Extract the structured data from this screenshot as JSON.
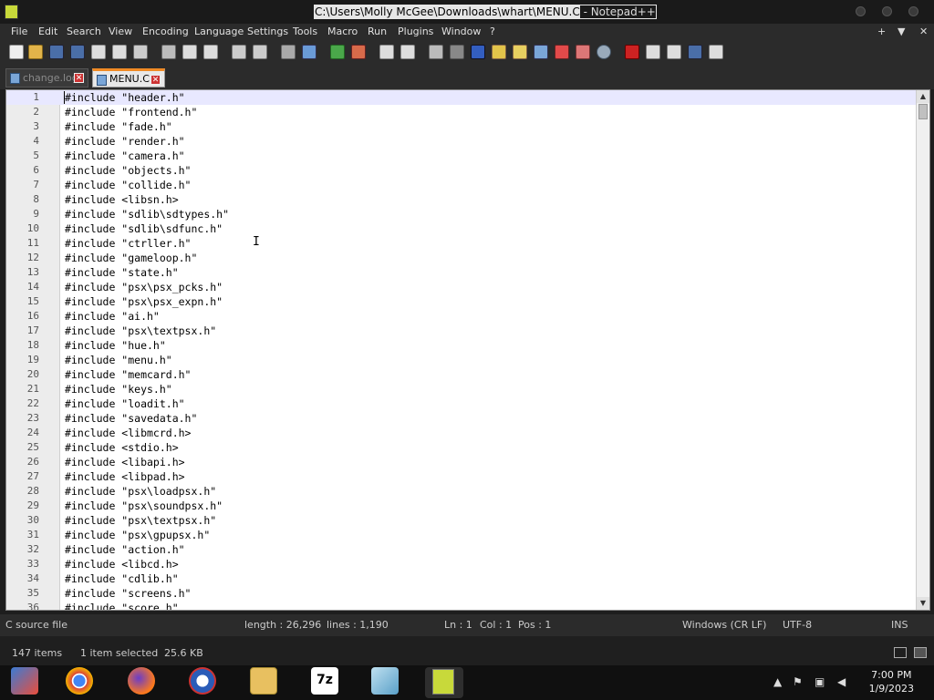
{
  "window": {
    "title_selected": "C:\\Users\\Molly McGee\\Downloads\\whart\\MENU.C",
    "title_rest": " - Notepad++"
  },
  "menu": [
    "File",
    "Edit",
    "Search",
    "View",
    "Encoding",
    "Language",
    "Settings",
    "Tools",
    "Macro",
    "Run",
    "Plugins",
    "Window",
    "?"
  ],
  "menu_right": {
    "plus": "+",
    "down": "▼",
    "close": "✕"
  },
  "tabs": [
    {
      "label": "change.log",
      "active": false
    },
    {
      "label": "MENU.C",
      "active": true
    }
  ],
  "editor": {
    "lines": [
      {
        "n": "1",
        "text": "#include \"header.h\""
      },
      {
        "n": "2",
        "text": "#include \"frontend.h\""
      },
      {
        "n": "3",
        "text": "#include \"fade.h\""
      },
      {
        "n": "4",
        "text": "#include \"render.h\""
      },
      {
        "n": "5",
        "text": "#include \"camera.h\""
      },
      {
        "n": "6",
        "text": "#include \"objects.h\""
      },
      {
        "n": "7",
        "text": "#include \"collide.h\""
      },
      {
        "n": "8",
        "text": "#include <libsn.h>"
      },
      {
        "n": "9",
        "text": "#include \"sdlib\\sdtypes.h\""
      },
      {
        "n": "10",
        "text": "#include \"sdlib\\sdfunc.h\""
      },
      {
        "n": "11",
        "text": "#include \"ctrller.h\""
      },
      {
        "n": "12",
        "text": "#include \"gameloop.h\""
      },
      {
        "n": "13",
        "text": "#include \"state.h\""
      },
      {
        "n": "14",
        "text": "#include \"psx\\psx_pcks.h\""
      },
      {
        "n": "15",
        "text": "#include \"psx\\psx_expn.h\""
      },
      {
        "n": "16",
        "text": "#include \"ai.h\""
      },
      {
        "n": "17",
        "text": "#include \"psx\\textpsx.h\""
      },
      {
        "n": "18",
        "text": "#include \"hue.h\""
      },
      {
        "n": "19",
        "text": "#include \"menu.h\""
      },
      {
        "n": "20",
        "text": "#include \"memcard.h\""
      },
      {
        "n": "21",
        "text": "#include \"keys.h\""
      },
      {
        "n": "22",
        "text": "#include \"loadit.h\""
      },
      {
        "n": "23",
        "text": "#include \"savedata.h\""
      },
      {
        "n": "24",
        "text": "#include <libmcrd.h>"
      },
      {
        "n": "25",
        "text": "#include <stdio.h>"
      },
      {
        "n": "26",
        "text": "#include <libapi.h>"
      },
      {
        "n": "27",
        "text": "#include <libpad.h>"
      },
      {
        "n": "28",
        "text": "#include \"psx\\loadpsx.h\""
      },
      {
        "n": "29",
        "text": "#include \"psx\\soundpsx.h\""
      },
      {
        "n": "30",
        "text": "#include \"psx\\textpsx.h\""
      },
      {
        "n": "31",
        "text": "#include \"psx\\gpupsx.h\""
      },
      {
        "n": "32",
        "text": "#include \"action.h\""
      },
      {
        "n": "33",
        "text": "#include <libcd.h>"
      },
      {
        "n": "34",
        "text": "#include \"cdlib.h\""
      },
      {
        "n": "35",
        "text": "#include \"screens.h\""
      },
      {
        "n": "36",
        "text": "#include \"score.h\""
      }
    ]
  },
  "status": {
    "file_type": "C source file",
    "length": "length : 26,296",
    "lines": "lines : 1,190",
    "ln": "Ln : 1",
    "col": "Col : 1",
    "pos": "Pos : 1",
    "eol": "Windows (CR LF)",
    "encoding": "UTF-8",
    "mode": "INS"
  },
  "explorer": {
    "items": "147 items",
    "selected": "1 item selected",
    "size": "25.6 KB"
  },
  "clock": {
    "time": "7:00 PM",
    "date": "1/9/2023"
  },
  "taskbar_apps": [
    "app-launcher-icon",
    "chrome-icon",
    "firefox-icon",
    "obama-logo-icon",
    "file-explorer-icon",
    "7zip-icon",
    "notebook-icon",
    "notepadpp-icon"
  ],
  "colors": {
    "active_tab_accent": "#f08a24",
    "current_line": "#e8e8ff"
  }
}
